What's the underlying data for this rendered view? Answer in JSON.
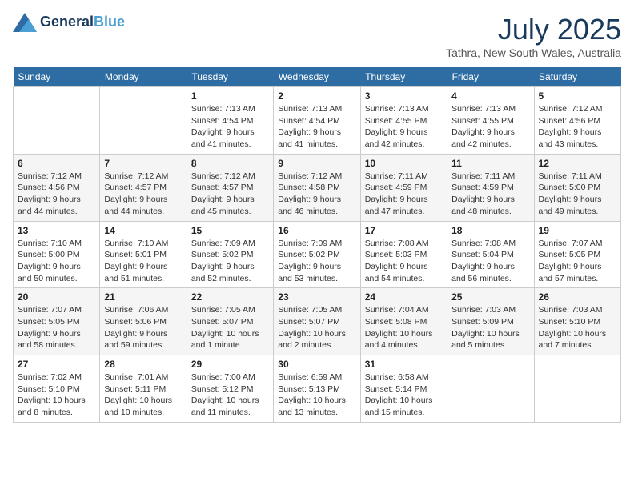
{
  "logo": {
    "line1": "General",
    "line2": "Blue"
  },
  "title": "July 2025",
  "subtitle": "Tathra, New South Wales, Australia",
  "weekdays": [
    "Sunday",
    "Monday",
    "Tuesday",
    "Wednesday",
    "Thursday",
    "Friday",
    "Saturday"
  ],
  "weeks": [
    [
      {
        "day": "",
        "info": ""
      },
      {
        "day": "",
        "info": ""
      },
      {
        "day": "1",
        "info": "Sunrise: 7:13 AM\nSunset: 4:54 PM\nDaylight: 9 hours and 41 minutes."
      },
      {
        "day": "2",
        "info": "Sunrise: 7:13 AM\nSunset: 4:54 PM\nDaylight: 9 hours and 41 minutes."
      },
      {
        "day": "3",
        "info": "Sunrise: 7:13 AM\nSunset: 4:55 PM\nDaylight: 9 hours and 42 minutes."
      },
      {
        "day": "4",
        "info": "Sunrise: 7:13 AM\nSunset: 4:55 PM\nDaylight: 9 hours and 42 minutes."
      },
      {
        "day": "5",
        "info": "Sunrise: 7:12 AM\nSunset: 4:56 PM\nDaylight: 9 hours and 43 minutes."
      }
    ],
    [
      {
        "day": "6",
        "info": "Sunrise: 7:12 AM\nSunset: 4:56 PM\nDaylight: 9 hours and 44 minutes."
      },
      {
        "day": "7",
        "info": "Sunrise: 7:12 AM\nSunset: 4:57 PM\nDaylight: 9 hours and 44 minutes."
      },
      {
        "day": "8",
        "info": "Sunrise: 7:12 AM\nSunset: 4:57 PM\nDaylight: 9 hours and 45 minutes."
      },
      {
        "day": "9",
        "info": "Sunrise: 7:12 AM\nSunset: 4:58 PM\nDaylight: 9 hours and 46 minutes."
      },
      {
        "day": "10",
        "info": "Sunrise: 7:11 AM\nSunset: 4:59 PM\nDaylight: 9 hours and 47 minutes."
      },
      {
        "day": "11",
        "info": "Sunrise: 7:11 AM\nSunset: 4:59 PM\nDaylight: 9 hours and 48 minutes."
      },
      {
        "day": "12",
        "info": "Sunrise: 7:11 AM\nSunset: 5:00 PM\nDaylight: 9 hours and 49 minutes."
      }
    ],
    [
      {
        "day": "13",
        "info": "Sunrise: 7:10 AM\nSunset: 5:00 PM\nDaylight: 9 hours and 50 minutes."
      },
      {
        "day": "14",
        "info": "Sunrise: 7:10 AM\nSunset: 5:01 PM\nDaylight: 9 hours and 51 minutes."
      },
      {
        "day": "15",
        "info": "Sunrise: 7:09 AM\nSunset: 5:02 PM\nDaylight: 9 hours and 52 minutes."
      },
      {
        "day": "16",
        "info": "Sunrise: 7:09 AM\nSunset: 5:02 PM\nDaylight: 9 hours and 53 minutes."
      },
      {
        "day": "17",
        "info": "Sunrise: 7:08 AM\nSunset: 5:03 PM\nDaylight: 9 hours and 54 minutes."
      },
      {
        "day": "18",
        "info": "Sunrise: 7:08 AM\nSunset: 5:04 PM\nDaylight: 9 hours and 56 minutes."
      },
      {
        "day": "19",
        "info": "Sunrise: 7:07 AM\nSunset: 5:05 PM\nDaylight: 9 hours and 57 minutes."
      }
    ],
    [
      {
        "day": "20",
        "info": "Sunrise: 7:07 AM\nSunset: 5:05 PM\nDaylight: 9 hours and 58 minutes."
      },
      {
        "day": "21",
        "info": "Sunrise: 7:06 AM\nSunset: 5:06 PM\nDaylight: 9 hours and 59 minutes."
      },
      {
        "day": "22",
        "info": "Sunrise: 7:05 AM\nSunset: 5:07 PM\nDaylight: 10 hours and 1 minute."
      },
      {
        "day": "23",
        "info": "Sunrise: 7:05 AM\nSunset: 5:07 PM\nDaylight: 10 hours and 2 minutes."
      },
      {
        "day": "24",
        "info": "Sunrise: 7:04 AM\nSunset: 5:08 PM\nDaylight: 10 hours and 4 minutes."
      },
      {
        "day": "25",
        "info": "Sunrise: 7:03 AM\nSunset: 5:09 PM\nDaylight: 10 hours and 5 minutes."
      },
      {
        "day": "26",
        "info": "Sunrise: 7:03 AM\nSunset: 5:10 PM\nDaylight: 10 hours and 7 minutes."
      }
    ],
    [
      {
        "day": "27",
        "info": "Sunrise: 7:02 AM\nSunset: 5:10 PM\nDaylight: 10 hours and 8 minutes."
      },
      {
        "day": "28",
        "info": "Sunrise: 7:01 AM\nSunset: 5:11 PM\nDaylight: 10 hours and 10 minutes."
      },
      {
        "day": "29",
        "info": "Sunrise: 7:00 AM\nSunset: 5:12 PM\nDaylight: 10 hours and 11 minutes."
      },
      {
        "day": "30",
        "info": "Sunrise: 6:59 AM\nSunset: 5:13 PM\nDaylight: 10 hours and 13 minutes."
      },
      {
        "day": "31",
        "info": "Sunrise: 6:58 AM\nSunset: 5:14 PM\nDaylight: 10 hours and 15 minutes."
      },
      {
        "day": "",
        "info": ""
      },
      {
        "day": "",
        "info": ""
      }
    ]
  ]
}
